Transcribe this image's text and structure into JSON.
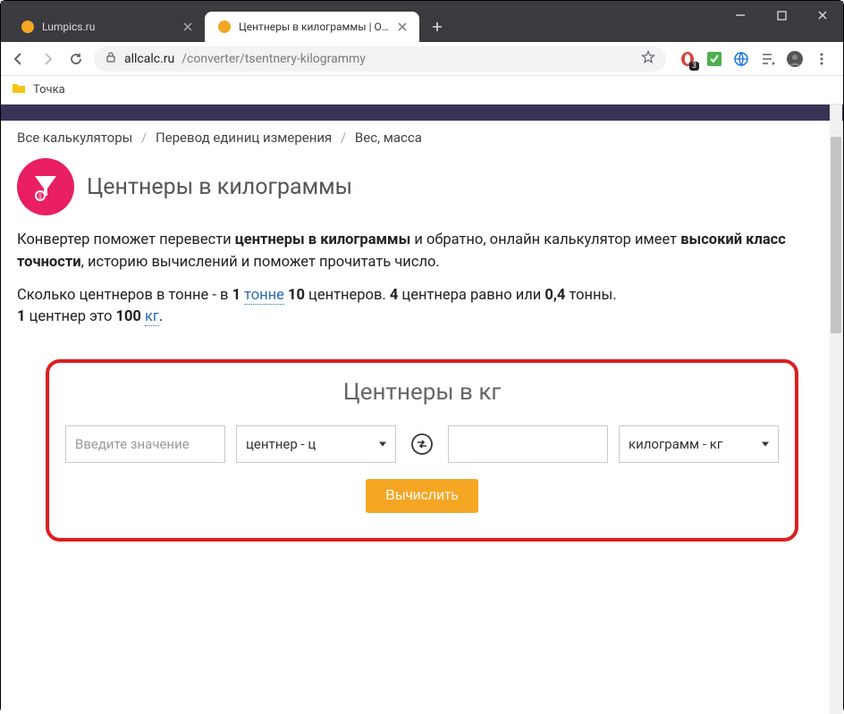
{
  "tabs": [
    {
      "label": "Lumpics.ru",
      "active": false,
      "fav": "orange-circle"
    },
    {
      "label": "Центнеры в килограммы | Онла",
      "active": true,
      "fav": "orange-circle"
    }
  ],
  "address": {
    "domain": "allcalc.ru",
    "path": "/converter/tsentnery-kilogrammy"
  },
  "bookmarks": [
    {
      "label": "Точка"
    }
  ],
  "breadcrumb": [
    "Все калькуляторы",
    "Перевод единиц измерения",
    "Вес, масса"
  ],
  "page_title": "Центнеры в килограммы",
  "intro": {
    "p1_prefix": "Конвертер поможет перевести ",
    "p1_bold1": "центнеры в килограммы",
    "p1_mid": " и обратно, онлайн калькулятор имеет ",
    "p1_bold2": "высокий класс точности",
    "p1_suffix": ", историю вычислений и поможет прочитать число.",
    "p2_prefix": "Сколько центнеров в тонне - в ",
    "p2_b1": "1",
    "p2_link": "тонне",
    "p2_b2": "10",
    "p2_mid": " центнеров. ",
    "p2_b3": "4",
    "p2_mid2": " центнера равно или ",
    "p2_b4": "0,4",
    "p2_suffix": " тонны.",
    "p3_b1": "1",
    "p3_mid": " центнер это ",
    "p3_b2": "100",
    "p3_link": "кг",
    "p3_suffix": "."
  },
  "converter": {
    "title": "Центнеры в кг",
    "input_placeholder": "Введите значение",
    "from_unit": "центнер - ц",
    "to_unit": "килограмм - кг",
    "button": "Вычислить"
  },
  "extension_badge": "3"
}
